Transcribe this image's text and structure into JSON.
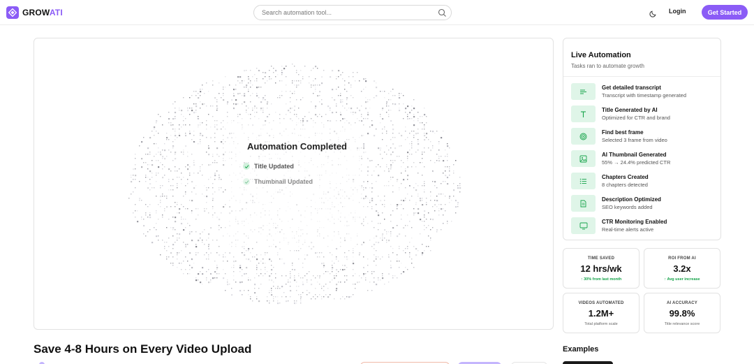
{
  "brand": {
    "name_main": "GROW",
    "name_accent": "ATI",
    "accent_color": "#8b5cf6"
  },
  "search": {
    "placeholder": "Search automation tool..."
  },
  "nav": {
    "login_label": "Login",
    "get_started_label": "Get Started"
  },
  "animation": {
    "title": "Automation Completed",
    "status_items": [
      "Title Updated",
      "Thumbnail Updated"
    ]
  },
  "live_automation": {
    "title": "Live Automation",
    "subtitle": "Tasks ran to automate growth",
    "tasks": [
      {
        "title": "Get detailed transcript",
        "desc": "Transcript with timestamp generated",
        "icon": "text-lines-icon"
      },
      {
        "title": "Title Generated by AI",
        "desc": "Optimized for CTR and brand",
        "icon": "type-icon"
      },
      {
        "title": "Find best frame",
        "desc": "Selected 3 frame from video",
        "icon": "target-icon"
      },
      {
        "title": "AI Thumbnail Generated",
        "desc": "55% → 24.4% predicted CTR",
        "icon": "image-icon"
      },
      {
        "title": "Chapters Created",
        "desc": "8 chapters detected",
        "icon": "list-icon"
      },
      {
        "title": "Description Optimized",
        "desc": "SEO keywords added",
        "icon": "document-icon"
      },
      {
        "title": "CTR Monitoring Enabled",
        "desc": "Real-time alerts active",
        "icon": "monitor-icon"
      }
    ]
  },
  "stats": [
    {
      "label": "TIME SAVED",
      "value": "12 hrs/wk",
      "note": "30% from last month",
      "trend": "up"
    },
    {
      "label": "ROI FROM AI",
      "value": "3.2x",
      "note": "Avg user increase",
      "trend": "up"
    },
    {
      "label": "VIDEOS AUTOMATED",
      "value": "1.2M+",
      "note": "Total platform scale",
      "trend": "none"
    },
    {
      "label": "AI ACCURACY",
      "value": "99.8%",
      "note": "Title relevance score",
      "trend": "none"
    }
  ],
  "sections": {
    "hero_title": "Save 4-8 Hours on Every Video Upload",
    "examples_title": "Examples"
  },
  "colors": {
    "task_icon_bg": "#dff5e8",
    "task_icon_fg": "#16a34a",
    "trend_up": "#16a34a"
  }
}
